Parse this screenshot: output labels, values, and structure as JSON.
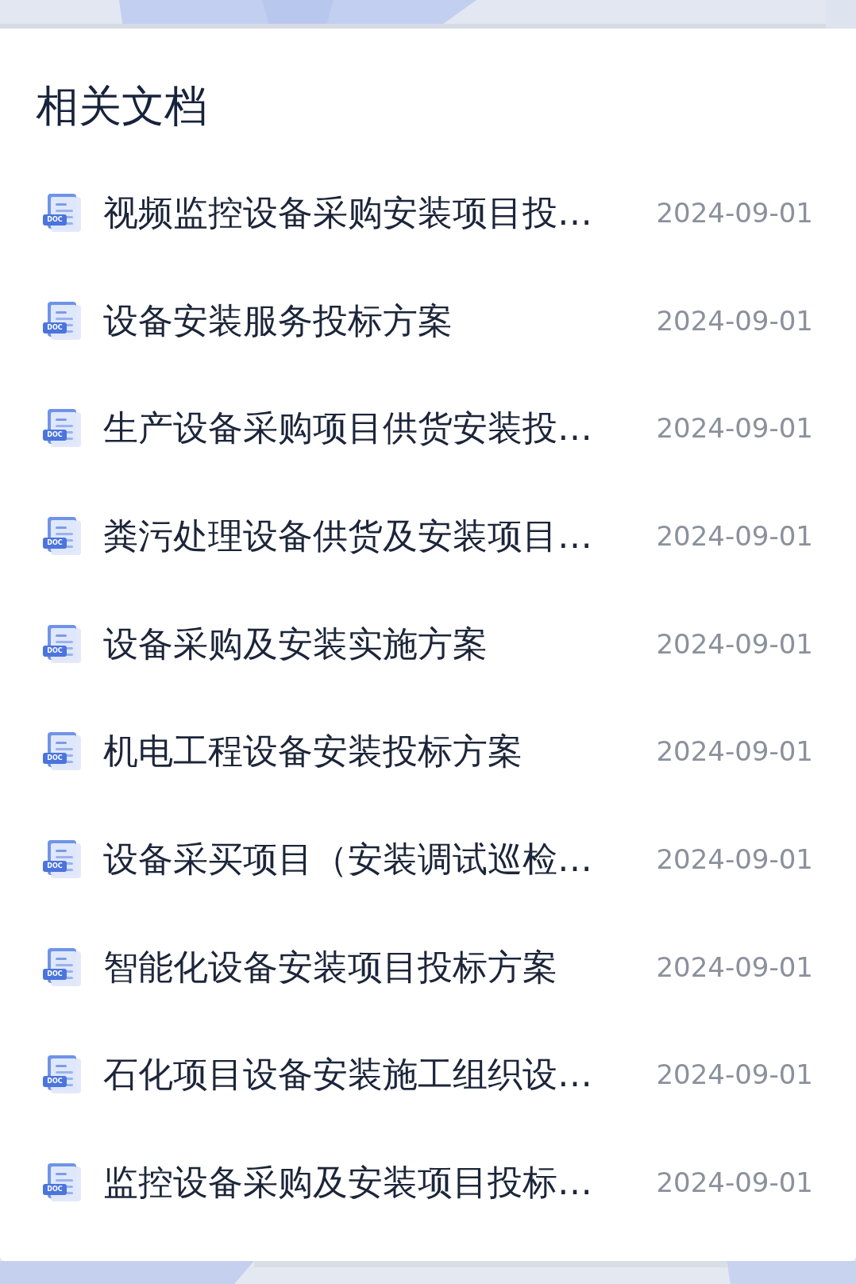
{
  "title": "相关文档",
  "documents": [
    {
      "name": "视频监控设备采购安装项目投…",
      "badge": "DOC",
      "date": "2024-09-01"
    },
    {
      "name": "设备安装服务投标方案",
      "badge": "DOC",
      "date": "2024-09-01"
    },
    {
      "name": "生产设备采购项目供货安装投…",
      "badge": "DOC",
      "date": "2024-09-01"
    },
    {
      "name": "粪污处理设备供货及安装项目…",
      "badge": "DOC",
      "date": "2024-09-01"
    },
    {
      "name": "设备采购及安装实施方案",
      "badge": "DOC",
      "date": "2024-09-01"
    },
    {
      "name": "机电工程设备安装投标方案",
      "badge": "DOC",
      "date": "2024-09-01"
    },
    {
      "name": "设备采买项目（安装调试巡检…",
      "badge": "DOC",
      "date": "2024-09-01"
    },
    {
      "name": "智能化设备安装项目投标方案",
      "badge": "DOC",
      "date": "2024-09-01"
    },
    {
      "name": "石化项目设备安装施工组织设…",
      "badge": "DOC",
      "date": "2024-09-01"
    },
    {
      "name": "监控设备采购及安装项目投标…",
      "badge": "DOC",
      "date": "2024-09-01"
    }
  ]
}
